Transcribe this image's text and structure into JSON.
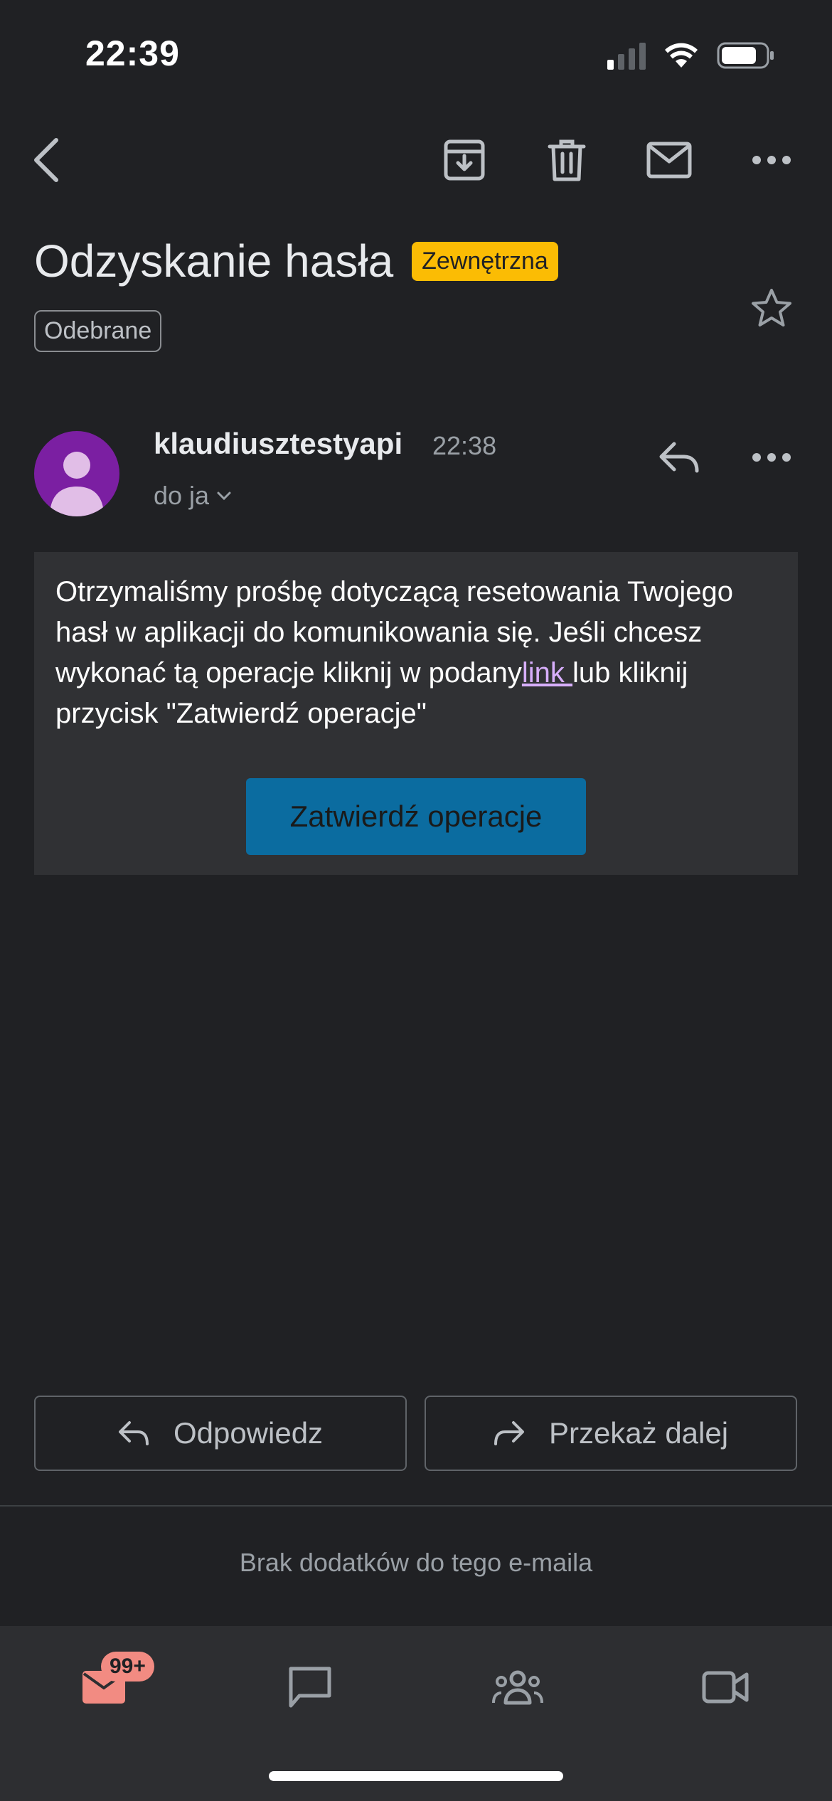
{
  "status_bar": {
    "time": "22:39"
  },
  "toolbar": {
    "back_icon": "chevron-left-icon",
    "archive_icon": "archive-icon",
    "delete_icon": "trash-icon",
    "mark_unread_icon": "mail-icon",
    "more_icon": "more-horizontal-icon"
  },
  "email": {
    "subject": "Odzyskanie hasła",
    "external_badge": "Zewnętrzna",
    "folder": "Odebrane",
    "sender": "klaudiusztestyapi",
    "time": "22:38",
    "recipients": "do ja",
    "body_before_link": "Otrzymaliśmy prośbę dotyczącą resetowania Twojego hasł w aplikacji do komunikowania się. Jeśli chcesz wykonać tą operacje kliknij w podany",
    "body_link": "link ",
    "body_after_link": "lub kliknij przycisk \"Zatwierdź operacje\"",
    "confirm_button": "Zatwierdź operacje"
  },
  "actions": {
    "reply": "Odpowiedz",
    "forward": "Przekaż dalej"
  },
  "attachments_note": "Brak dodatków do tego e-maila",
  "bottom_nav": {
    "mail_badge": "99+",
    "items": [
      "mail-icon",
      "chat-icon",
      "spaces-icon",
      "meet-icon"
    ]
  },
  "colors": {
    "background": "#202124",
    "accent_badge": "#fbbc04",
    "confirm_button": "#0b6ca0",
    "link": "#d7aefb",
    "mail_active": "#f28b82"
  }
}
